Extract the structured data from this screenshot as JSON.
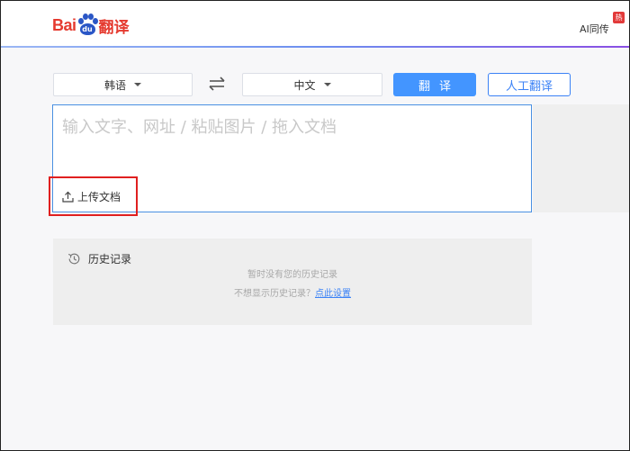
{
  "header": {
    "logo_text": "Bai",
    "logo_du": "du",
    "logo_fanyi": "翻译",
    "ai_link": "AI同传",
    "hot_badge": "热",
    "accent_line_colors": [
      "#9bb7f4",
      "#8a4fe3"
    ]
  },
  "toolbar": {
    "source_language": "韩语",
    "target_language": "中文",
    "swap_icon": "swap-arrows-icon",
    "translate_label": "翻译",
    "human_translate_label": "人工翻译"
  },
  "input": {
    "placeholder": "输入文字、网址 / 粘贴图片 / 拖入文档",
    "upload_label": "上传文档",
    "upload_icon": "upload-icon"
  },
  "history": {
    "title": "历史记录",
    "icon": "history-clock-icon",
    "empty_text": "暂时没有您的历史记录",
    "hint_prefix": "不想显示历史记录？",
    "hint_link": "点此设置"
  },
  "colors": {
    "brand_red": "#e53a2f",
    "brand_blue": "#2a56c6",
    "primary_button": "#4395ff",
    "highlight": "#e02020"
  }
}
